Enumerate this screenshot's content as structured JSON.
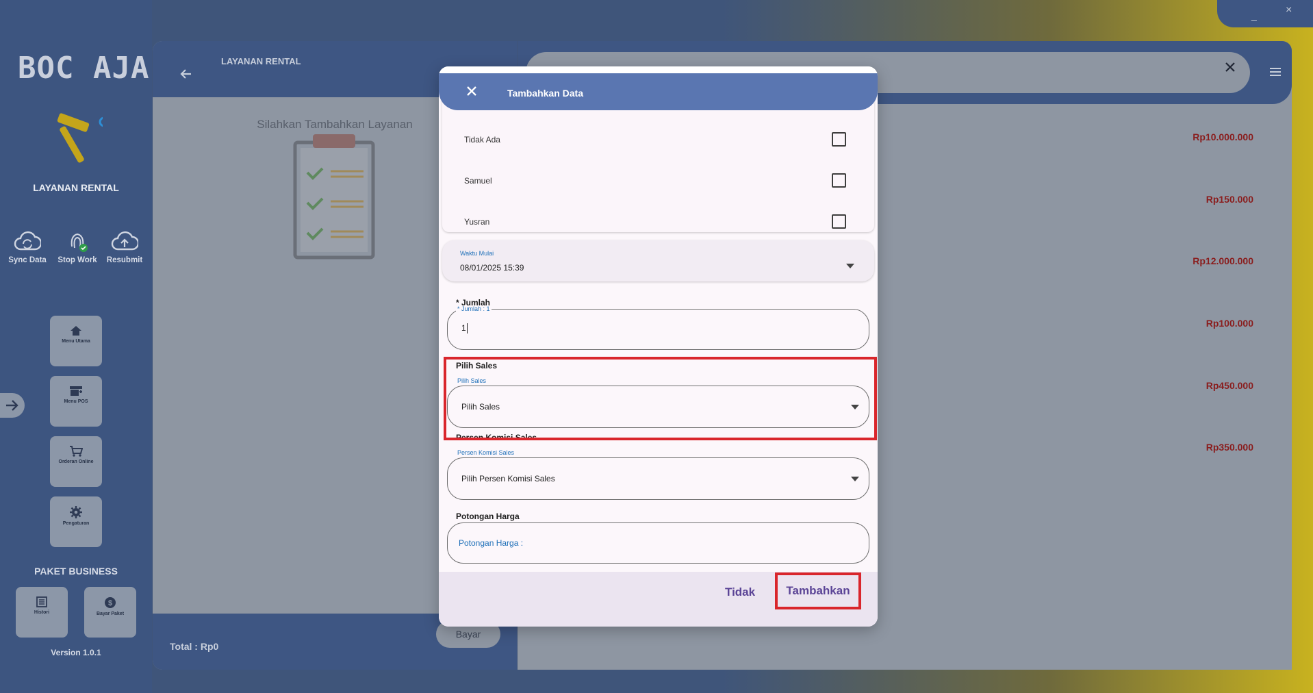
{
  "sidebar": {
    "logo_text": "BOC AJA",
    "title": "LAYANAN RENTAL",
    "quick_actions": [
      {
        "label": "Sync Data"
      },
      {
        "label": "Stop Work"
      },
      {
        "label": "Resubmit"
      }
    ],
    "menu": [
      {
        "label": "Menu Utama"
      },
      {
        "label": "Menu POS"
      },
      {
        "label": "Orderan Online"
      },
      {
        "label": "Pengaturan"
      }
    ],
    "paket_title": "PAKET BUSINESS",
    "paket": [
      {
        "label": "Histori"
      },
      {
        "label": "Bayar Paket"
      }
    ],
    "version": "Version 1.0.1"
  },
  "middle": {
    "title": "LAYANAN RENTAL",
    "empty_text": "Silahkan Tambahkan Layanan",
    "total_label": "Total :  Rp0",
    "bayar_label": "Bayar"
  },
  "right": {
    "prices": [
      "Rp10.000.000",
      "Rp150.000",
      "Rp12.000.000",
      "Rp100.000",
      "Rp450.000",
      "Rp350.000"
    ]
  },
  "window": {
    "minimize": "_",
    "close": "×"
  },
  "modal": {
    "title": "Tambahkan Data",
    "checkbox_items": [
      "Tidak Ada",
      "Samuel",
      "Yusran"
    ],
    "waktu_mulai": {
      "label": "Waktu Mulai",
      "value": "08/01/2025 15:39"
    },
    "jumlah": {
      "section_label": "* Jumlah",
      "float_label": "* Jumlah : 1",
      "value": "1"
    },
    "sales": {
      "section_label": "Pilih Sales",
      "float_label": "Pilih Sales",
      "value": "Pilih Sales"
    },
    "komisi": {
      "section_label": "Persen Komisi Sales",
      "float_label": "Persen Komisi Sales",
      "value": "Pilih Persen Komisi Sales"
    },
    "potongan": {
      "section_label": "Potongan Harga",
      "placeholder": "Potongan Harga :"
    },
    "btn_cancel": "Tidak",
    "btn_submit": "Tambahkan"
  },
  "colors": {
    "primary": "#5a76b1",
    "sidebar": "#3d5580",
    "price": "#8a1d1d",
    "highlight": "#d9262c",
    "button_text": "#5b4496"
  }
}
